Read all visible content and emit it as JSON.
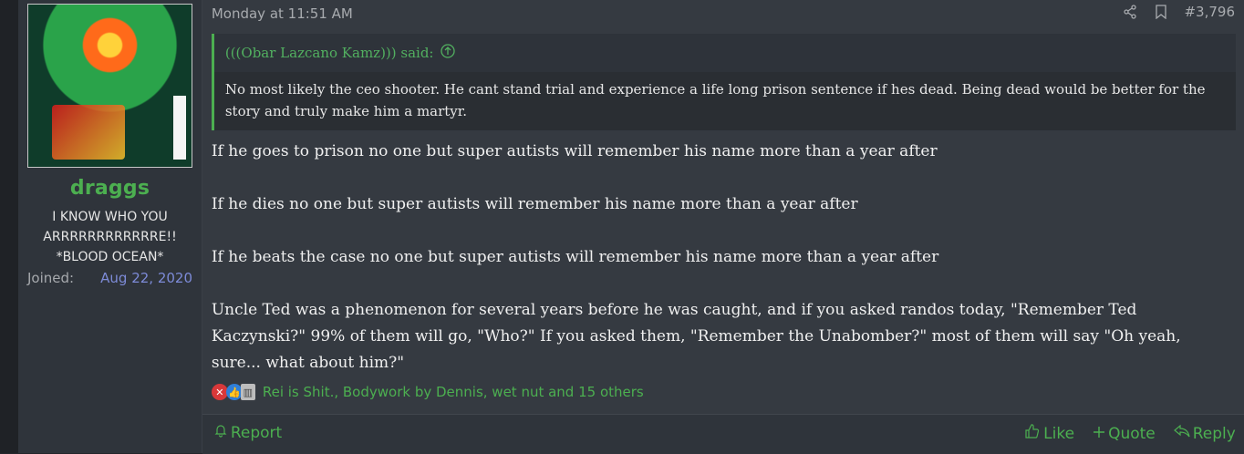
{
  "user": {
    "name": "draggs",
    "title_lines": [
      "I KNOW WHO YOU",
      "ARRRRRRRRRRRRE!!",
      "*BLOOD OCEAN*"
    ],
    "joined_label": "Joined:",
    "joined_date": "Aug 22, 2020"
  },
  "post": {
    "date": "Monday at 11:51 AM",
    "number": "#3,796",
    "quote": {
      "author": "(((Obar Lazcano Kamz))) said:",
      "text": "No most likely the ceo shooter. He cant stand trial and experience a life long prison sentence if hes dead. Being dead would be better for the story and truly make him a martyr."
    },
    "paragraphs": [
      "If he goes to prison no one but super autists will remember his name more than a year after",
      "If he dies no one but super autists will remember his name more than a year after",
      "If he beats the case no one but super autists will remember his name more than a year after",
      "Uncle Ted was a phenomenon for several years before he was caught, and if you asked randos today, \"Remember Ted Kaczynski?\" 99% of them will go, \"Who?\" If you asked them, \"Remember the Unabomber?\" most of them will say \"Oh yeah, sure... what about him?\""
    ],
    "reactions": {
      "icons": [
        "no-reaction-icon",
        "like-reaction-icon",
        "other-reaction-icon"
      ],
      "text": "Rei is Shit., Bodywork by Dennis, wet nut and 15 others"
    }
  },
  "footer": {
    "report": "Report",
    "like": "Like",
    "quote": "Quote",
    "reply": "Reply"
  },
  "colors": {
    "accent_green": "#4caf50",
    "joined_date": "#7d8bd8",
    "background": "#353a41"
  }
}
